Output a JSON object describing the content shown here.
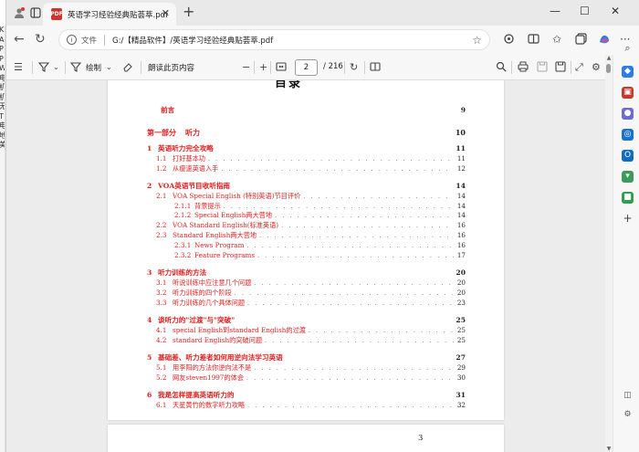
{
  "left_strip_chars": [
    "K",
    "A",
    "P",
    "P",
    "W",
    "电",
    "机",
    "机",
    "无",
    "T",
    "电",
    "地",
    "美"
  ],
  "tab": {
    "title": "英语学习经验经典贴荟萃.pdf",
    "favicon": "PDF"
  },
  "address": {
    "label": "文件",
    "url": "G:/【精品软件】/英语学习经验经典贴荟萃.pdf"
  },
  "pdf_toolbar": {
    "draw_label": "绘制",
    "read_aloud_label": "朗读此页内容",
    "page_current": "2",
    "page_total": "/ 216"
  },
  "document": {
    "toc_title": "目录",
    "page_footer_number": "3",
    "entries": [
      {
        "num": "",
        "title": "前言",
        "page": "9",
        "level": "preface"
      },
      {
        "num": "第一部分",
        "title": "听力",
        "page": "10",
        "level": "part"
      },
      {
        "num": "1",
        "title": "英语听力完全攻略",
        "page": "11",
        "level": "chapter"
      },
      {
        "num": "1.1",
        "title": "打好基本功",
        "page": "11",
        "level": "section"
      },
      {
        "num": "1.2",
        "title": "从瘦速英语入手",
        "page": "12",
        "level": "section"
      },
      {
        "num": "2",
        "title": "VOA英语节目收听指南",
        "page": "14",
        "level": "chapter"
      },
      {
        "num": "2.1",
        "title": "VOA Special English (特别英语)节目评价",
        "page": "14",
        "level": "section"
      },
      {
        "num": "2.1.1",
        "title": "背景提示",
        "page": "14",
        "level": "subsection"
      },
      {
        "num": "2.1.2",
        "title": "Special English两大营地",
        "page": "14",
        "level": "subsection"
      },
      {
        "num": "2.2",
        "title": "VOA Standard English(标准英语)",
        "page": "16",
        "level": "section"
      },
      {
        "num": "2.3",
        "title": "Standard English两大营地",
        "page": "16",
        "level": "section"
      },
      {
        "num": "2.3.1",
        "title": "News Program",
        "page": "16",
        "level": "subsection"
      },
      {
        "num": "2.3.2",
        "title": "Feature Programs",
        "page": "17",
        "level": "subsection"
      },
      {
        "num": "3",
        "title": "听力训练的方法",
        "page": "20",
        "level": "chapter"
      },
      {
        "num": "3.1",
        "title": "听说训练中应注意几个问题",
        "page": "20",
        "level": "section"
      },
      {
        "num": "3.2",
        "title": "听力训练的四个阶段",
        "page": "20",
        "level": "section"
      },
      {
        "num": "3.3",
        "title": "听力训练的几个具体问题",
        "page": "23",
        "level": "section"
      },
      {
        "num": "4",
        "title": "谈听力的\"过渡\"与\"突破\"",
        "page": "25",
        "level": "chapter"
      },
      {
        "num": "4.1",
        "title": "special English到standard English的过渡",
        "page": "25",
        "level": "section"
      },
      {
        "num": "4.2",
        "title": "standard English的突破问题",
        "page": "25",
        "level": "section"
      },
      {
        "num": "5",
        "title": "基础差、听力差者如何用逆向法学习英语",
        "page": "27",
        "level": "chapter"
      },
      {
        "num": "5.1",
        "title": "用李阳的方法你逆向法不是",
        "page": "29",
        "level": "section"
      },
      {
        "num": "5.2",
        "title": "网友steven1997的体会",
        "page": "30",
        "level": "section"
      },
      {
        "num": "6",
        "title": "我是怎样提高英语听力的",
        "page": "31",
        "level": "chapter"
      },
      {
        "num": "6.1",
        "title": "天星黄竹的数字听力攻略",
        "page": "32",
        "level": "section"
      }
    ]
  },
  "colors": {
    "toc_red": "#e02020",
    "accent_blue": "#0a63d6"
  }
}
